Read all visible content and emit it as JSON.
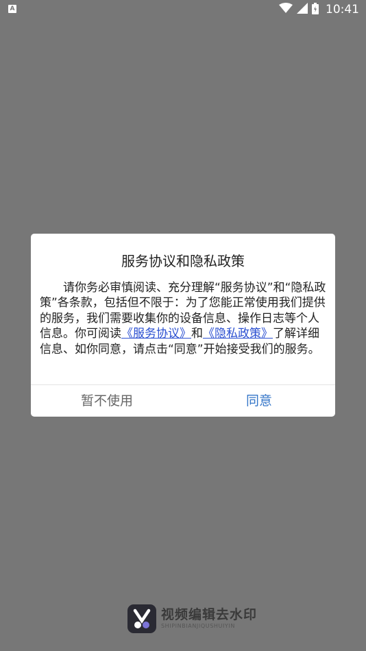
{
  "status_bar": {
    "notification_icon_letter": "A",
    "time": "10:41",
    "icons": [
      "wifi-icon",
      "signal-icon",
      "battery-icon"
    ]
  },
  "dialog": {
    "title": "服务协议和隐私政策",
    "body_part1": "请你务必审慎阅读、充分理解“服务协议”和“隐私政策”各条款，包括但不限于：为了您能正常使用我们提供的服务，我们需要收集你的设备信息、操作日志等个人信息。你可阅读",
    "link_service": "《服务协议》",
    "body_and": "和",
    "link_privacy": "《隐私政策》",
    "body_part2": "了解详细信息、如你同意，请点击“同意”开始接受我们的服务。",
    "decline_label": "暂不使用",
    "agree_label": "同意"
  },
  "brand": {
    "name": "视频编辑去水印",
    "subtitle": "SHIPINBIANJIQUSHUIYIN"
  },
  "colors": {
    "overlay": "#777777",
    "link": "#2a4fd1",
    "agree": "#3576c8"
  }
}
